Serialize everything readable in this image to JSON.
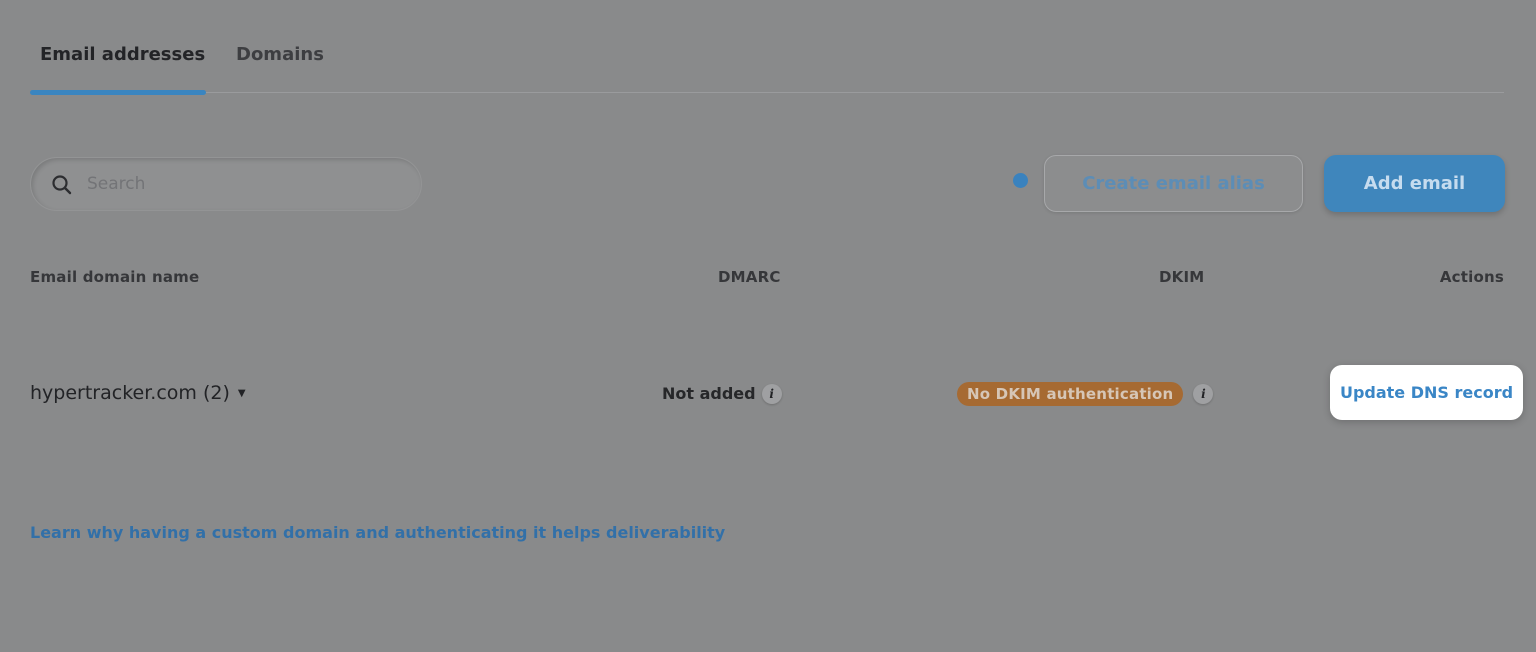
{
  "tabs": [
    {
      "label": "Email addresses",
      "active": true
    },
    {
      "label": "Domains",
      "active": false
    }
  ],
  "toolbar": {
    "search_placeholder": "Search",
    "create_alias_label": "Create email alias",
    "add_email_label": "Add email"
  },
  "table": {
    "columns": [
      "Email domain name",
      "DMARC",
      "DKIM",
      "Actions"
    ],
    "rows": [
      {
        "domain": "hypertracker.com (2)",
        "dmarc": "Not added",
        "dkim": "No DKIM authentication",
        "action": "Update DNS record"
      }
    ]
  },
  "footer": {
    "learn_link": "Learn why having a custom domain and authenticating it helps deliverability"
  },
  "icons": {
    "search": "search-icon",
    "info": "info-icon",
    "caret": "caret-down-icon",
    "status_dot": "status-dot"
  },
  "colors": {
    "accent": "#3a85c0",
    "badge_warning": "#a66a32",
    "link": "#3270a8",
    "overlay": "#898a8b"
  }
}
